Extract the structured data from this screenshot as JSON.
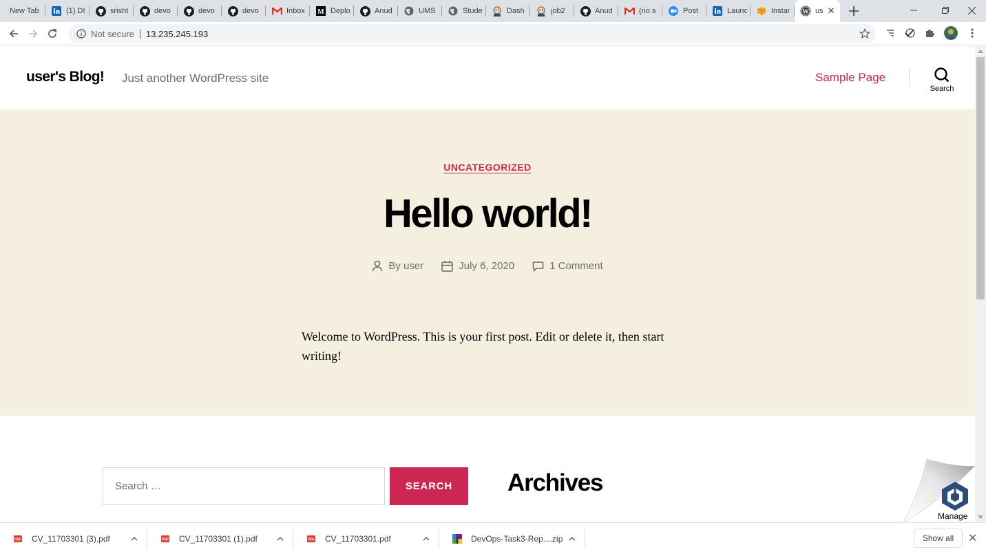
{
  "browser": {
    "tabs": [
      {
        "label": "New Tab",
        "icon": "none"
      },
      {
        "label": "(1) DI",
        "icon": "linkedin-icon"
      },
      {
        "label": "srisht",
        "icon": "github-icon"
      },
      {
        "label": "devo",
        "icon": "github-icon"
      },
      {
        "label": "devo",
        "icon": "github-icon"
      },
      {
        "label": "devo",
        "icon": "github-icon"
      },
      {
        "label": "Inbox",
        "icon": "gmail-icon"
      },
      {
        "label": "Deplo",
        "icon": "medium-icon"
      },
      {
        "label": "Anud",
        "icon": "github-icon"
      },
      {
        "label": "UMS",
        "icon": "globe-icon"
      },
      {
        "label": "Stude",
        "icon": "globe-icon"
      },
      {
        "label": "Dash",
        "icon": "jenkins-icon"
      },
      {
        "label": "job2",
        "icon": "jenkins-icon"
      },
      {
        "label": "Anud",
        "icon": "github-icon"
      },
      {
        "label": "(no s",
        "icon": "gmail-icon"
      },
      {
        "label": "Post",
        "icon": "zoom-icon"
      },
      {
        "label": "Launc",
        "icon": "linkedin-icon"
      },
      {
        "label": "Instar",
        "icon": "aws-icon"
      }
    ],
    "active_tab": {
      "label": "us",
      "icon": "wordpress-icon"
    },
    "security_label": "Not secure",
    "url": "13.235.245.193"
  },
  "page": {
    "site_title": "user's Blog!",
    "site_description": "Just another WordPress site",
    "menu": [
      "Sample Page"
    ],
    "search_toggle_label": "Search",
    "post": {
      "category": "UNCATEGORIZED",
      "title": "Hello world!",
      "author": "By user",
      "date": "July 6, 2020",
      "comments": "1 Comment",
      "content": "Welcome to WordPress. This is your first post. Edit or delete it, then start writing!"
    },
    "widgets": {
      "search_placeholder": "Search …",
      "search_button": "SEARCH",
      "archives_title": "Archives"
    },
    "manage_label": "Manage"
  },
  "downloads": {
    "items": [
      {
        "name": "CV_11703301 (3).pdf",
        "type": "pdf"
      },
      {
        "name": "CV_11703301 (1).pdf",
        "type": "pdf"
      },
      {
        "name": "CV_11703301.pdf",
        "type": "pdf"
      },
      {
        "name": "DevOps-Task3-Rep....zip",
        "type": "zip"
      }
    ],
    "show_all": "Show all"
  },
  "colors": {
    "accent": "#cd2653",
    "hero_bg": "#f5efe0",
    "meta_text": "#6d6d6d"
  }
}
